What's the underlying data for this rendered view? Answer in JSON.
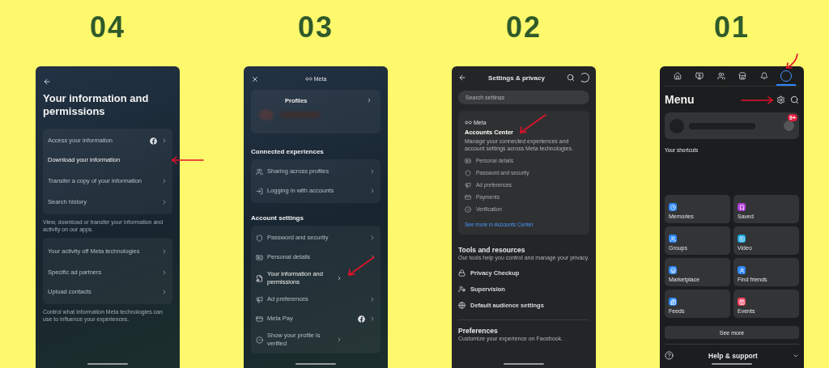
{
  "steps": [
    {
      "number": "04",
      "screen": {
        "kind": "info",
        "title": "Your information and permissions",
        "groups": [
          {
            "items": [
              {
                "label": "Access your information",
                "facebook": true,
                "chevron": true,
                "pointed": false
              },
              {
                "label": "Download your information",
                "facebook": false,
                "chevron": false,
                "pointed": true
              },
              {
                "label": "Transfer a copy of your information",
                "facebook": false,
                "chevron": true,
                "pointed": false
              },
              {
                "label": "Search history",
                "facebook": false,
                "chevron": true,
                "pointed": false
              }
            ],
            "note": "View, download or transfer your information and activity on our apps."
          },
          {
            "items": [
              {
                "label": "Your activity off Meta technologies",
                "facebook": false,
                "chevron": true,
                "pointed": false
              },
              {
                "label": "Specific ad partners",
                "facebook": false,
                "chevron": true,
                "pointed": false
              },
              {
                "label": "Upload contacts",
                "facebook": false,
                "chevron": true,
                "pointed": false
              }
            ],
            "note": "Control what information Meta technologies can use to influence your experiences."
          }
        ]
      }
    },
    {
      "number": "03",
      "screen": {
        "kind": "accounts",
        "brand": "Meta",
        "profiles_label": "Profiles",
        "sections": [
          {
            "title": "Connected experiences",
            "items": [
              {
                "kind": "people",
                "label": "Sharing across profiles",
                "facebook": false,
                "pointed": false
              },
              {
                "kind": "login",
                "label": "Logging in with accounts",
                "facebook": false,
                "pointed": false
              }
            ]
          },
          {
            "title": "Account settings",
            "items": [
              {
                "kind": "shield",
                "label": "Password and security",
                "facebook": false,
                "pointed": false
              },
              {
                "kind": "id",
                "label": "Personal details",
                "facebook": false,
                "pointed": false
              },
              {
                "kind": "file",
                "label": "Your information and permissions",
                "facebook": false,
                "pointed": true
              },
              {
                "kind": "megaphone",
                "label": "Ad preferences",
                "facebook": false,
                "pointed": false
              },
              {
                "kind": "card",
                "label": "Meta Pay",
                "facebook": true,
                "pointed": false
              },
              {
                "kind": "check",
                "label": "Show your profile is verified",
                "facebook": false,
                "pointed": false
              }
            ]
          }
        ]
      }
    },
    {
      "number": "02",
      "screen": {
        "kind": "settings",
        "title": "Settings & privacy",
        "search_placeholder": "Search settings",
        "center": {
          "brand": "Meta",
          "title": "Accounts Center",
          "pointed": true,
          "description": "Manage your connected experiences and account settings across Meta technologies.",
          "items": [
            {
              "kind": "id",
              "label": "Personal details"
            },
            {
              "kind": "shield",
              "label": "Password and security"
            },
            {
              "kind": "megaphone",
              "label": "Ad preferences"
            },
            {
              "kind": "card",
              "label": "Payments"
            },
            {
              "kind": "check",
              "label": "Verification"
            }
          ],
          "link": "See more in Accounts Center"
        },
        "sections": [
          {
            "title": "Tools and resources",
            "description": "Our tools help you control and manage your privacy.",
            "items": [
              {
                "kind": "lock",
                "label": "Privacy Checkup"
              },
              {
                "kind": "supervision",
                "label": "Supervision"
              },
              {
                "kind": "globe",
                "label": "Default audience settings"
              }
            ]
          },
          {
            "title": "Preferences",
            "description": "Customize your experience on Facebook."
          }
        ]
      }
    },
    {
      "number": "01",
      "screen": {
        "kind": "menu",
        "tabs": [
          {
            "kind": "home",
            "selected": false,
            "pointed": false
          },
          {
            "kind": "video",
            "selected": false,
            "pointed": false
          },
          {
            "kind": "friends",
            "selected": false,
            "pointed": false
          },
          {
            "kind": "shop",
            "selected": false,
            "pointed": false
          },
          {
            "kind": "bell",
            "selected": false,
            "pointed": false
          },
          {
            "kind": "profile",
            "selected": true,
            "pointed": true
          }
        ],
        "title": "Menu",
        "settings_pointed": true,
        "badge": "9+",
        "shortcuts_label": "Your shortcuts",
        "tiles": [
          {
            "kind": "clock",
            "label": "Memories",
            "color": "#2d88ff"
          },
          {
            "kind": "bookmark",
            "label": "Saved",
            "color": "#b03fd9"
          },
          {
            "kind": "users",
            "label": "Groups",
            "color": "#2d88ff"
          },
          {
            "kind": "play",
            "label": "Video",
            "color": "#1ea7e4"
          },
          {
            "kind": "store",
            "label": "Marketplace",
            "color": "#2d88ff"
          },
          {
            "kind": "user",
            "label": "Find friends",
            "color": "#2d88ff"
          },
          {
            "kind": "feeds",
            "label": "Feeds",
            "color": "#2d88ff"
          },
          {
            "kind": "calendar",
            "label": "Events",
            "color": "#f3425f"
          }
        ],
        "see_more": "See more",
        "help": "Help & support"
      }
    }
  ]
}
